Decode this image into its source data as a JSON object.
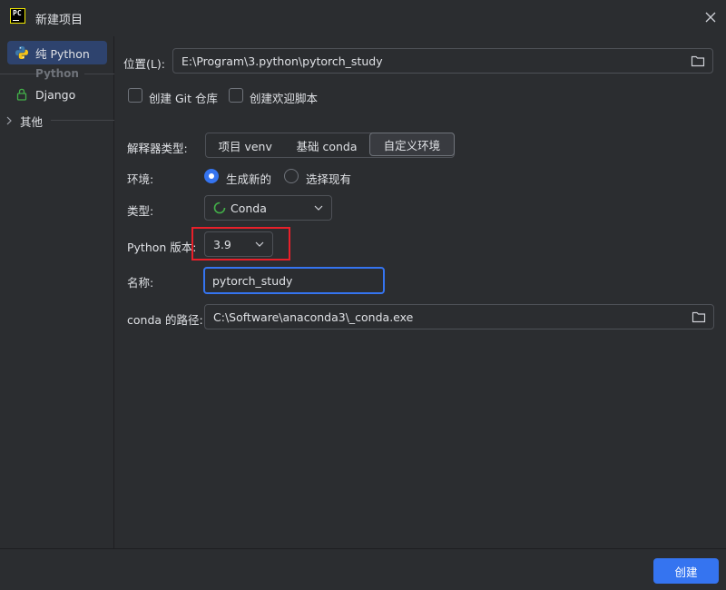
{
  "window": {
    "title": "新建项目",
    "logo_text": "PC"
  },
  "sidebar": {
    "items": [
      {
        "label": "纯 Python",
        "icon": "python-icon",
        "selected": true
      },
      {
        "group": "Python"
      },
      {
        "label": "Django",
        "icon": "lock-icon",
        "selected": false
      },
      {
        "label": "其他",
        "icon": "chevron-right-icon",
        "collapsed": true
      }
    ]
  },
  "form": {
    "location": {
      "label": "位置(L):",
      "value": "E:\\Program\\3.python\\pytorch_study"
    },
    "create_git_repo": {
      "label": "创建 Git 仓库",
      "checked": false
    },
    "create_welcome_script": {
      "label": "创建欢迎脚本",
      "checked": false
    },
    "interpreter_type": {
      "label": "解释器类型:",
      "options": [
        "项目 venv",
        "基础 conda",
        "自定义环境"
      ],
      "selected": "自定义环境"
    },
    "environment": {
      "label": "环境:",
      "options": [
        "生成新的",
        "选择现有"
      ],
      "selected": "生成新的"
    },
    "type": {
      "label": "类型:",
      "value": "Conda",
      "icon": "conda-icon"
    },
    "python_version": {
      "label": "Python 版本:",
      "value": "3.9"
    },
    "name": {
      "label": "名称:",
      "value": "pytorch_study"
    },
    "conda_path": {
      "label": "conda 的路径:",
      "value": "C:\\Software\\anaconda3\\_conda.exe"
    }
  },
  "footer": {
    "create_label": "创建"
  },
  "colors": {
    "background": "#2b2d30",
    "accent": "#3574f0",
    "selected": "#2e436e",
    "highlight": "#e8202a",
    "conda": "#43b049"
  }
}
